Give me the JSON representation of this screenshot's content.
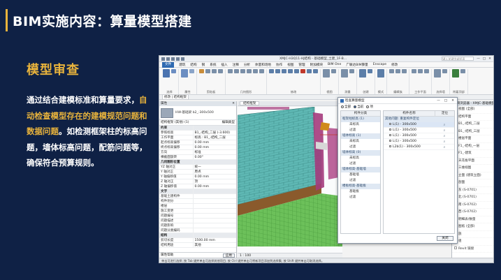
{
  "slide": {
    "title": "BIM实施内容：算量模型搭建",
    "section_title": "模型审查",
    "desc_parts": [
      "通过结合建模标准和算量要求，",
      "自动检查模型存在的建模规范问题和数据问题",
      "。如检测框架柱的标高问题，墙体标高问题，配筋问题等，确保符合预算规则。"
    ],
    "accent_color": "#e8b33c",
    "background_color": "#0f2145"
  },
  "app": {
    "title": "XMJC-H3Q11-HJ结构 - 基础模型_土建_1F-B...",
    "search_placeholder": "键入关键字或短语",
    "window_controls": [
      "—",
      "□",
      "✕"
    ],
    "menu": [
      "文件",
      "建筑",
      "结构",
      "钢",
      "系统",
      "插入",
      "注释",
      "分析",
      "体量和场地",
      "协作",
      "视图",
      "管理",
      "附加模块",
      "BIM One",
      "广联达BIM算量",
      "Enscape",
      "修改"
    ],
    "ribbon_groups": [
      {
        "label": "选择",
        "icons": [
          "#4b74b0",
          "#6c8ec2"
        ]
      },
      {
        "label": "属性",
        "icons": [
          "#6c8ec2",
          "#8aa4c8"
        ]
      },
      {
        "label": "剪贴板",
        "icons": [
          "#c98d3a",
          "#7a8fa8",
          "#7a8fa8",
          "#7a8fa8"
        ]
      },
      {
        "label": "几何图形",
        "icons": [
          "#7a8fa8",
          "#7a8fa8",
          "#7a8fa8",
          "#7a8fa8",
          "#7a8fa8",
          "#7a8fa8"
        ]
      },
      {
        "label": "修改",
        "icons": [
          "#5c7ea8",
          "#5c7ea8",
          "#5c7ea8",
          "#5c7ea8",
          "#5c7ea8",
          "#c0392b",
          "#5c7ea8",
          "#5c7ea8"
        ]
      },
      {
        "label": "视图",
        "icons": [
          "#7a8fa8",
          "#7a8fa8"
        ]
      },
      {
        "label": "测量",
        "icons": [
          "#7a8fa8",
          "#7a8fa8"
        ]
      },
      {
        "label": "创建",
        "icons": [
          "#5c7ea8",
          "#5c7ea8"
        ]
      },
      {
        "label": "模式",
        "icons": [
          "#5c7ea8"
        ]
      },
      {
        "label": "编辑族",
        "icons": [
          "#7a8fa8",
          "#7a8fa8",
          "#7a8fa8"
        ]
      },
      {
        "label": "工作平面",
        "icons": [
          "#7a8fa8",
          "#7a8fa8",
          "#7a8fa8"
        ]
      },
      {
        "label": "选择墙",
        "icons": [
          "#7a8fa8",
          "#7a8fa8"
        ]
      },
      {
        "label": "附着顶部",
        "icons": [
          "#3a7f3d",
          "#7a8fa8"
        ]
      }
    ],
    "options_bar": [
      "修改 | 结构框架"
    ],
    "properties": {
      "header": "属性",
      "type_name": "HW-基础梁 b2_-300x500",
      "filter": "结构框架 (其他) (1)",
      "edit_type": "编辑类型",
      "rows": [
        {
          "cat": true,
          "k": "约束",
          "v": ""
        },
        {
          "k": "参照标高",
          "v": "B1_-结构_二层 (-3.600)"
        },
        {
          "k": "工作平面",
          "v": "标高 : B1_-结构_二层"
        },
        {
          "k": "起点标高偏移",
          "v": "0.00 mm"
        },
        {
          "k": "终点标高偏移",
          "v": "0.00 mm"
        },
        {
          "k": "方向",
          "v": "标准"
        },
        {
          "k": "横截面旋转",
          "v": "0.00°"
        },
        {
          "cat": true,
          "k": "几何图形位置",
          "v": ""
        },
        {
          "k": "YZ 轴对正",
          "v": "统一"
        },
        {
          "k": "Y 轴对正",
          "v": "原点"
        },
        {
          "k": "Y 轴偏移值",
          "v": "0.00 mm"
        },
        {
          "k": "Z 轴对正",
          "v": "顶"
        },
        {
          "k": "Z 轴偏移值",
          "v": "0.00 mm"
        },
        {
          "cat": true,
          "k": "文字",
          "v": ""
        },
        {
          "k": "基础土建构件",
          "v": ""
        },
        {
          "k": "构件划分",
          "v": ""
        },
        {
          "k": "楼层",
          "v": ""
        },
        {
          "k": "施工变更",
          "v": ""
        },
        {
          "k": "问题编号",
          "v": ""
        },
        {
          "k": "问题描述",
          "v": ""
        },
        {
          "k": "问题影响",
          "v": ""
        },
        {
          "k": "问题分类编码",
          "v": ""
        },
        {
          "cat": true,
          "k": "结构",
          "v": ""
        },
        {
          "k": "剪切长度",
          "v": "1500.00 mm"
        },
        {
          "k": "结构用途",
          "v": "其他"
        }
      ],
      "help_link": "属性帮助",
      "apply": "应用"
    },
    "view_tab": "结构框架",
    "view_control": "1 : 100",
    "browser": {
      "header": "项目浏览器 - XMJC-基础模型",
      "items": [
        "视图 (全部)",
        "结构平面",
        "B1_-结构_二层",
        "B1_-结构_三层",
        "楼层平面",
        "F1_-结构_一层",
        "F1_-建筑",
        "天花板平面",
        "三维视图",
        "立面 (建筑立面)",
        "剖面",
        "东 (S-0701)",
        "北 (S-0701)",
        "南 (S-0702)",
        "西 (S-0702)",
        "明细表/数量",
        "图纸 (全部)",
        "族",
        "组",
        "Revit 链接"
      ]
    },
    "status_bar": "单击可进行选择; 按 Tab 键并单击可选择其他项目; 按 Ctrl 键并单击可将新项目添加到选择集; 按 Shift 键并单击可取消选择。"
  },
  "dialog": {
    "title": "检查算量模型",
    "options": [
      {
        "label": "全部",
        "selected": false
      },
      {
        "label": "当前",
        "selected": true
      },
      {
        "label": "项",
        "selected": false
      }
    ],
    "left_header": "构件分类",
    "right_header_name": "构件名称",
    "right_header_locate": "定位",
    "groups": [
      {
        "name": "框架柱标高 (1)",
        "subs": [
          "未标高",
          "过滤"
        ]
      },
      {
        "name": "墙体标高 (1)",
        "subs": [
          "未标高",
          "过滤"
        ]
      },
      {
        "name": "墙体标高 (0)",
        "subs": [
          "未标高",
          "过滤"
        ]
      },
      {
        "name": "墙体标高-基础墙",
        "subs": [
          "基础墙",
          "过滤"
        ]
      },
      {
        "name": "楼板标高-基础板",
        "subs": [
          "基础板",
          "过滤"
        ]
      }
    ],
    "right_group": "其他问题: 重复构件定位",
    "right_items": [
      "L(1) - 300x500",
      "L(1) - 300x500",
      "L(1) - 300x500",
      "L(1) - 300x500",
      "L2b(1) - 300x500"
    ],
    "close_label": "关闭"
  }
}
